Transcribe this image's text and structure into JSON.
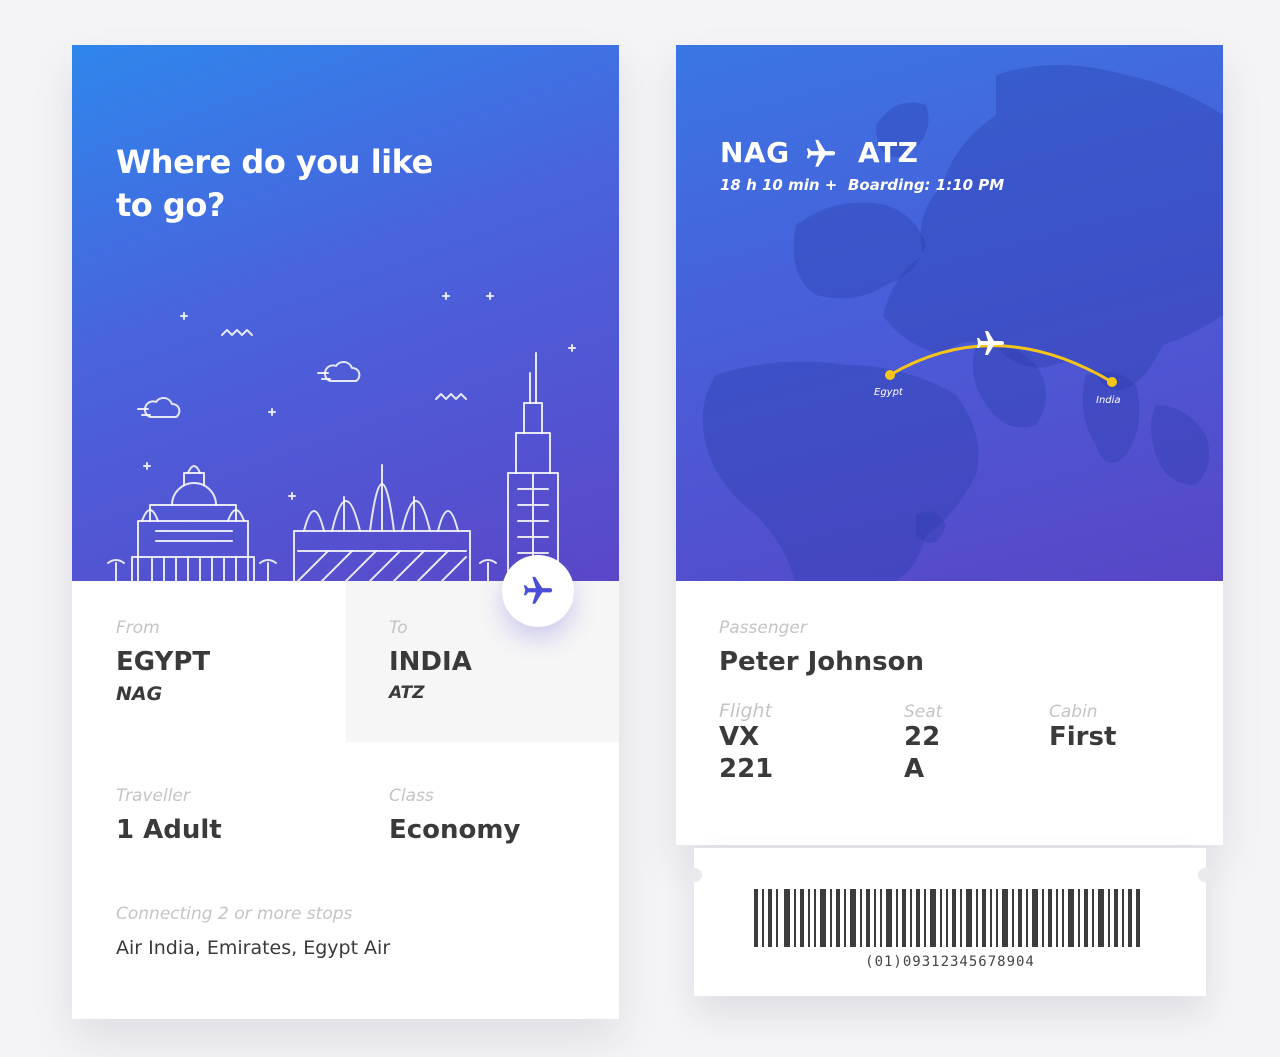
{
  "search_card": {
    "headline": "Where do you like to go?",
    "from": {
      "label": "From",
      "country": "EGYPT",
      "code": "NAG"
    },
    "to": {
      "label": "To",
      "country": "INDIA",
      "code": "ATZ"
    },
    "traveller": {
      "label": "Traveller",
      "value": "1 Adult"
    },
    "class": {
      "label": "Class",
      "value": "Economy"
    },
    "connecting": {
      "label": "Connecting 2 or more stops",
      "value": "Air India, Emirates, Egypt Air"
    },
    "fab_icon": "airplane-icon"
  },
  "ticket_card": {
    "origin_code": "NAG",
    "destination_code": "ATZ",
    "duration": "18 h 10 min +",
    "boarding": "Boarding: 1:10 PM",
    "map": {
      "origin_label": "Egypt",
      "destination_label": "India"
    },
    "passenger": {
      "label": "Passenger",
      "value": "Peter Johnson"
    },
    "flight": {
      "label": "Flight",
      "line1": "VX",
      "line2": "221"
    },
    "seat": {
      "label": "Seat",
      "line1": "22",
      "line2": "A"
    },
    "cabin": {
      "label": "Cabin",
      "value": "First"
    },
    "barcode_number": "(01)09312345678904"
  },
  "colors": {
    "gradient_start": "#2f86ec",
    "gradient_end": "#5a47c8",
    "route_line": "#f5c518",
    "accent_icon": "#4b4ed8"
  }
}
